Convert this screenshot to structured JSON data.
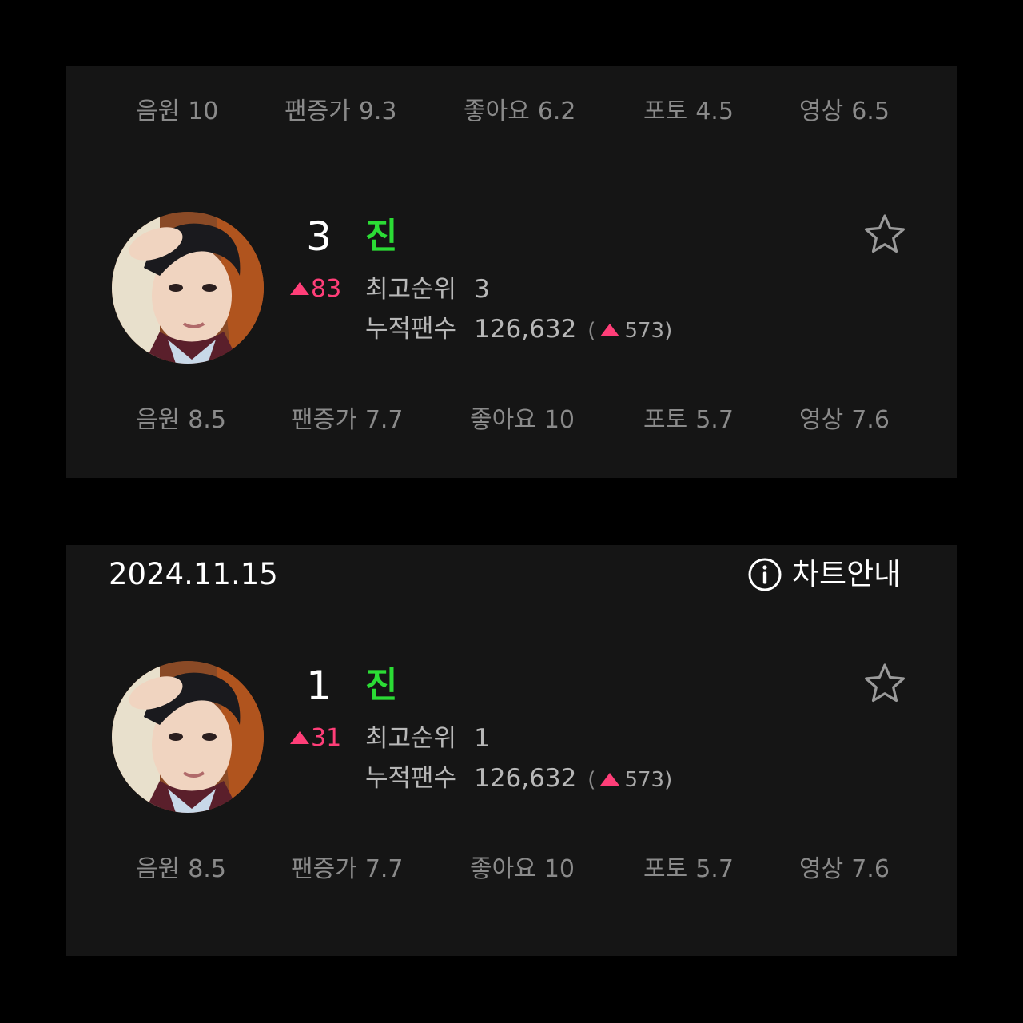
{
  "top_card": {
    "scores_prev": [
      {
        "label": "음원",
        "value": "10"
      },
      {
        "label": "팬증가",
        "value": "9.3"
      },
      {
        "label": "좋아요",
        "value": "6.2"
      },
      {
        "label": "포토",
        "value": "4.5"
      },
      {
        "label": "영상",
        "value": "6.5"
      }
    ],
    "entry": {
      "rank": "3",
      "name": "진",
      "change": "83",
      "best_rank_label": "최고순위",
      "best_rank": "3",
      "fans_label": "누적팬수",
      "fans": "126,632",
      "fans_open": "(",
      "fans_increase": "573)"
    },
    "scores": [
      {
        "label": "음원",
        "value": "8.5"
      },
      {
        "label": "팬증가",
        "value": "7.7"
      },
      {
        "label": "좋아요",
        "value": "10"
      },
      {
        "label": "포토",
        "value": "5.7"
      },
      {
        "label": "영상",
        "value": "7.6"
      }
    ]
  },
  "bottom_card": {
    "date": "2024.11.15",
    "guide_label": "차트안내",
    "entry": {
      "rank": "1",
      "name": "진",
      "change": "31",
      "best_rank_label": "최고순위",
      "best_rank": "1",
      "fans_label": "누적팬수",
      "fans": "126,632",
      "fans_open": "(",
      "fans_increase": "573)"
    },
    "scores": [
      {
        "label": "음원",
        "value": "8.5"
      },
      {
        "label": "팬증가",
        "value": "7.7"
      },
      {
        "label": "좋아요",
        "value": "10"
      },
      {
        "label": "포토",
        "value": "5.7"
      },
      {
        "label": "영상",
        "value": "7.6"
      }
    ]
  },
  "icons": {
    "favorite": "star-outline-icon",
    "info": "info-circle-icon",
    "up": "up-triangle-icon"
  },
  "colors": {
    "background": "#000000",
    "panel": "#151515",
    "name": "#2bdc35",
    "increase": "#ff3e78",
    "muted_text": "#8a8a8a"
  }
}
